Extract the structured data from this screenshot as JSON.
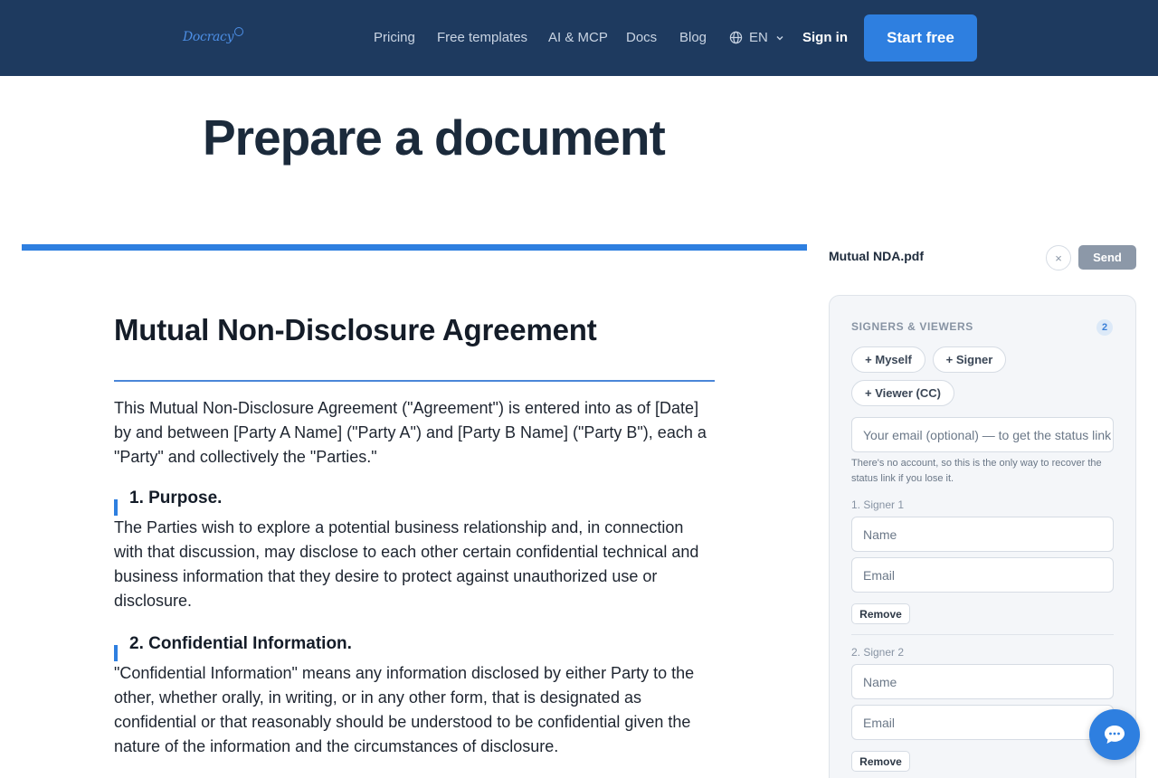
{
  "header": {
    "logo_text": "Docracy",
    "nav": [
      "Pricing",
      "Free templates",
      "AI & MCP",
      "Docs",
      "Blog"
    ],
    "language": "EN",
    "signin": "Sign in",
    "cta": "Start free"
  },
  "page": {
    "title": "Prepare a document"
  },
  "document": {
    "progress": 1.0,
    "title": "Mutual Non-Disclosure Agreement",
    "intro": "This Mutual Non-Disclosure Agreement (\"Agreement\") is entered into as of [Date] by and between [Party A Name] (\"Party A\") and [Party B Name] (\"Party B\"), each a \"Party\" and collectively the \"Parties.\"",
    "sections": [
      {
        "heading": "1. Purpose.",
        "body": "The Parties wish to explore a potential business relationship and, in connection with that discussion, may disclose to each other certain confidential technical and business information that they desire to protect against unauthorized use or disclosure."
      },
      {
        "heading": "2. Confidential Information.",
        "body": "\"Confidential Information\" means any information disclosed by either Party to the other, whether orally, in writing, or in any other form, that is designated as confidential or that reasonably should be understood to be confidential given the nature of the information and the circumstances of disclosure."
      }
    ]
  },
  "sidebar": {
    "file_name": "Mutual NDA.pdf",
    "close_glyph": "×",
    "send": "Send",
    "signers_label": "SIGNERS & VIEWERS",
    "signers_count": "2",
    "add_buttons": [
      "+ Myself",
      "+ Signer",
      "+ Viewer (CC)"
    ],
    "email_placeholder": "Your email (optional) — to get the status link",
    "hint": "There's no account, so this is the only way to recover the status link if you lose it.",
    "signers": [
      {
        "label": "1. Signer 1",
        "name_placeholder": "Name",
        "email_placeholder": "Email",
        "remove": "Remove"
      },
      {
        "label": "2. Signer 2",
        "name_placeholder": "Name",
        "email_placeholder": "Email",
        "remove": "Remove"
      }
    ]
  },
  "icons": {
    "globe": "globe-icon",
    "chevron": "chevron-down-icon",
    "chat": "chat-bubble-icon"
  },
  "colors": {
    "header_bg": "#1e3a5f",
    "accent": "#2e7fe0",
    "send_disabled": "#8c98a8"
  }
}
